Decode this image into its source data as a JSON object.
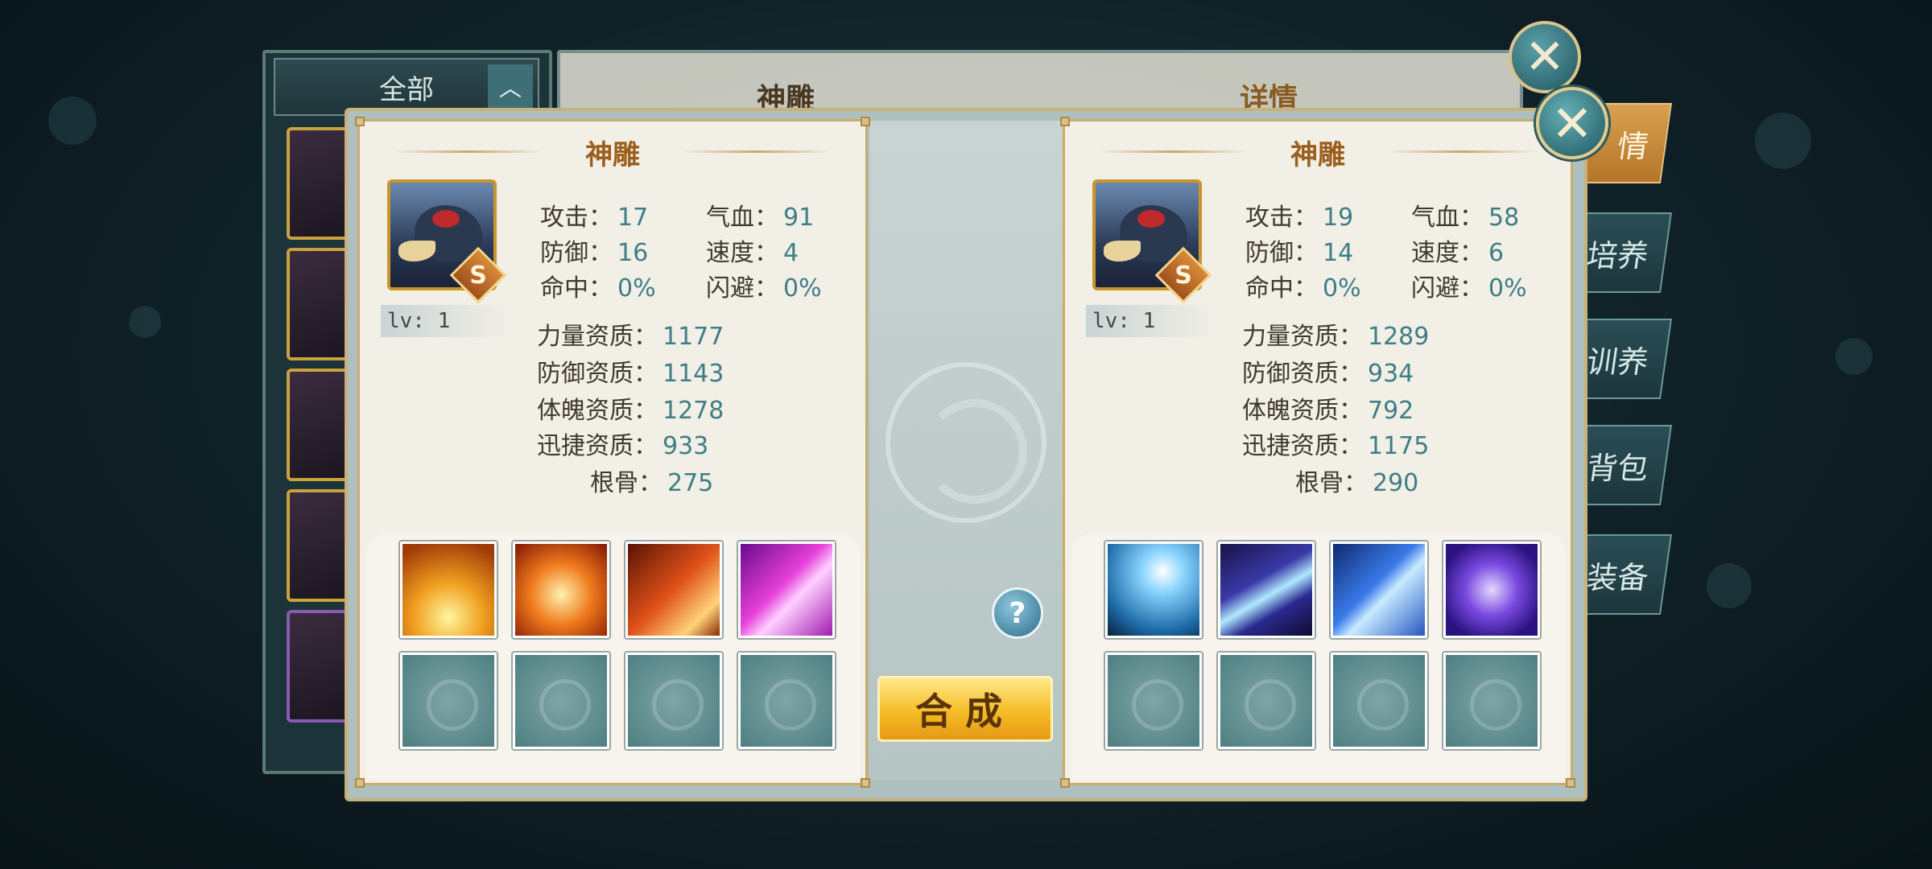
{
  "background": {
    "filter_label": "全部",
    "panel_title": "神雕",
    "detail_title": "详情",
    "side_tabs": [
      "情",
      "培养",
      "训养",
      "背包",
      "装备"
    ]
  },
  "left_pet": {
    "title": "神雕",
    "grade": "S",
    "level": "lv: 1",
    "stats": {
      "attack_label": "攻击：",
      "attack": "17",
      "hp_label": "气血：",
      "hp": "91",
      "defense_label": "防御：",
      "defense": "16",
      "speed_label": "速度：",
      "speed": "4",
      "hit_label": "命中：",
      "hit": "0%",
      "dodge_label": "闪避：",
      "dodge": "0%"
    },
    "aptitudes": {
      "strength_label": "力量资质：",
      "strength": "1177",
      "defense_label": "防御资质：",
      "defense": "1143",
      "physique_label": "体魄资质：",
      "physique": "1278",
      "agility_label": "迅捷资质：",
      "agility": "933",
      "bone_label": "根骨：",
      "bone": "275"
    },
    "skills": [
      "golden-burst-icon",
      "phoenix-flame-icon",
      "fire-bird-icon",
      "pink-slash-icon"
    ]
  },
  "right_pet": {
    "title": "神雕",
    "grade": "S",
    "level": "lv: 1",
    "stats": {
      "attack_label": "攻击：",
      "attack": "19",
      "hp_label": "气血：",
      "hp": "58",
      "defense_label": "防御：",
      "defense": "14",
      "speed_label": "速度：",
      "speed": "6",
      "hit_label": "命中：",
      "hit": "0%",
      "dodge_label": "闪避：",
      "dodge": "0%"
    },
    "aptitudes": {
      "strength_label": "力量资质：",
      "strength": "1289",
      "defense_label": "防御资质：",
      "defense": "934",
      "physique_label": "体魄资质：",
      "physique": "792",
      "agility_label": "迅捷资质：",
      "agility": "1175",
      "bone_label": "根骨：",
      "bone": "290"
    },
    "skills": [
      "lightning-icon",
      "claw-slash-icon",
      "blue-arrow-icon",
      "vortex-icon"
    ]
  },
  "actions": {
    "combine_label": "合成",
    "help_label": "?",
    "close_label": "✕"
  },
  "colors": {
    "accent_gold": "#f6bc26",
    "value_teal": "#3f7e86",
    "title_brown": "#9c5e1c"
  }
}
